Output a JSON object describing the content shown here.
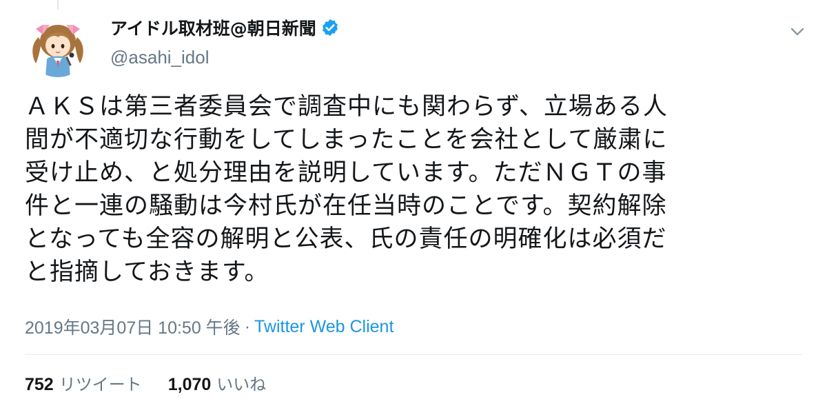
{
  "tweet": {
    "author": {
      "display_name": "アイドル取材班@朝日新聞",
      "handle": "@asahi_idol",
      "verified": true,
      "avatar_icon": "idol-girl-avatar"
    },
    "text": "ＡＫＳは第三者委員会で調査中にも関わらず、立場ある人\n間が不適切な行動をしてしまったことを会社として厳粛に\n受け止め、と処分理由を説明しています。ただＮＧＴの事\n件と一連の騒動は今村氏が在任当時のことです。契約解除\nとなっても全容の解明と公表、氏の責任の明確化は必須だ\nと指摘しておきます。",
    "timestamp": "2019年03月07日 10:50 午後",
    "separator": "·",
    "client": "Twitter Web Client",
    "stats": {
      "retweets_count": "752",
      "retweets_label": "リツイート",
      "likes_count": "1,070",
      "likes_label": "いいね"
    }
  },
  "colors": {
    "text": "#14171a",
    "secondary": "#657786",
    "link": "#1b95e0",
    "verified_badge": "#1da1f2",
    "divider": "#e6ecf0"
  },
  "icons": {
    "verified": "verified-badge-icon",
    "more": "chevron-down-icon"
  }
}
